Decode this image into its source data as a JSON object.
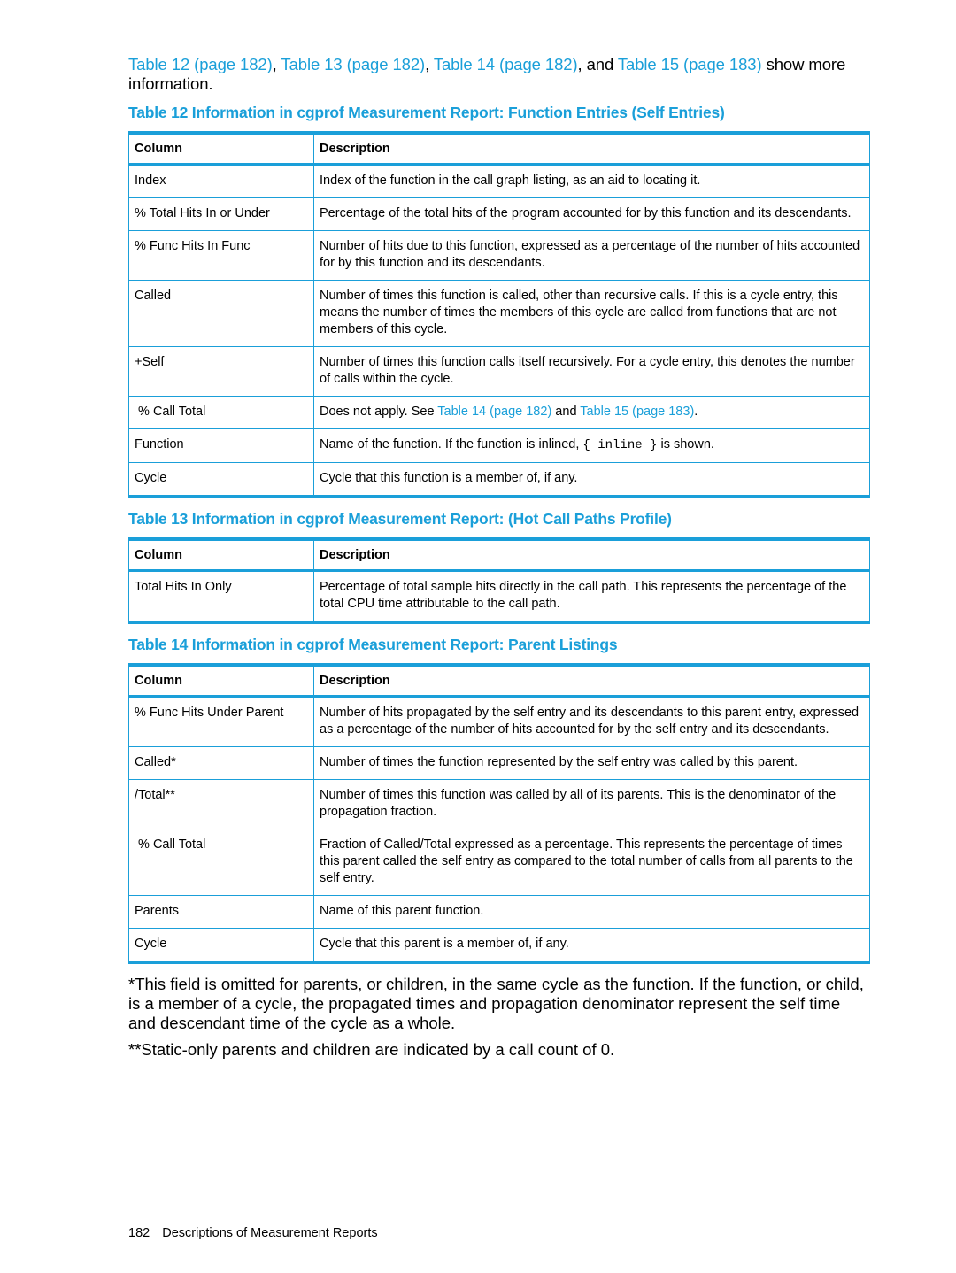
{
  "intro": {
    "links": [
      {
        "label": "Table 12 (page 182)"
      },
      {
        "label": "Table 13 (page 182)"
      },
      {
        "label": "Table 14 (page 182)"
      },
      {
        "label": "Table 15 (page 183)"
      }
    ],
    "sep1": ", ",
    "sep2": ", ",
    "sep3": ", and ",
    "tail": " show more information."
  },
  "tables": [
    {
      "caption": "Table 12 Information in cgprof Measurement Report: Function Entries (Self Entries)",
      "headers": [
        "Column",
        "Description"
      ],
      "rows": [
        {
          "column": "Index",
          "description": "Index of the function in the call graph listing, as an aid to locating it."
        },
        {
          "column": "% Total Hits In or Under",
          "description": "Percentage of the total hits of the program accounted for by this function and its descendants."
        },
        {
          "column": "% Func Hits In Func",
          "description": "Number of hits due to this function, expressed as a percentage of the number of hits accounted for by this function and its descendants."
        },
        {
          "column": "Called",
          "description": "Number of times this function is called, other than recursive calls. If this is a cycle entry, this means the number of times the members of this cycle are called from functions that are not members of this cycle."
        },
        {
          "column": "+Self",
          "description": "Number of times this function calls itself recursively. For a cycle entry, this denotes the number of calls within the cycle."
        },
        {
          "column": " % Call Total",
          "description_parts": {
            "pre": "Does not apply. See ",
            "link1": "Table 14 (page 182)",
            "mid": " and ",
            "link2": "Table 15 (page 183)",
            "post": "."
          }
        },
        {
          "column": "Function",
          "description_parts": {
            "pre": "Name of the function. If the function is inlined, ",
            "code": "{ inline }",
            "post": " is shown."
          }
        },
        {
          "column": "Cycle",
          "description": "Cycle that this function is a member of, if any."
        }
      ]
    },
    {
      "caption": "Table 13 Information in cgprof Measurement Report: (Hot Call Paths Profile)",
      "headers": [
        "Column",
        "Description"
      ],
      "rows": [
        {
          "column": "Total Hits In Only",
          "description": "Percentage of total sample hits directly in the call path. This represents the percentage of the total CPU time attributable to the call path."
        }
      ]
    },
    {
      "caption": "Table 14 Information in cgprof Measurement Report: Parent Listings",
      "headers": [
        "Column",
        "Description"
      ],
      "rows": [
        {
          "column": "% Func Hits Under Parent",
          "description": "Number of hits propagated by the self entry and its descendants to this parent entry, expressed as a percentage of the number of hits accounted for by the self entry and its descendants."
        },
        {
          "column": "Called*",
          "description": "Number of times the function represented by the self entry was called by this parent."
        },
        {
          "column": "/Total**",
          "description": "Number of times this function was called by all of its parents. This is the denominator of the propagation fraction."
        },
        {
          "column": " % Call Total",
          "description": "Fraction of Called/Total expressed as a percentage. This represents the percentage of times this parent called the self entry as compared to the total number of calls from all parents to the self entry."
        },
        {
          "column": "Parents",
          "description": "Name of this parent function."
        },
        {
          "column": "Cycle",
          "description": "Cycle that this parent is a member of, if any."
        }
      ]
    }
  ],
  "notes": [
    "*This field is omitted for parents, or children, in the same cycle as the function. If the function, or child, is a member of a cycle, the propagated times and propagation denominator represent the self time and descendant time of the cycle as a whole.",
    "**Static-only parents and children are indicated by a call count of 0."
  ],
  "footer": {
    "page_number": "182",
    "section": "Descriptions of Measurement Reports"
  },
  "colors": {
    "accent": "#1a9fd9",
    "text": "#000000"
  }
}
